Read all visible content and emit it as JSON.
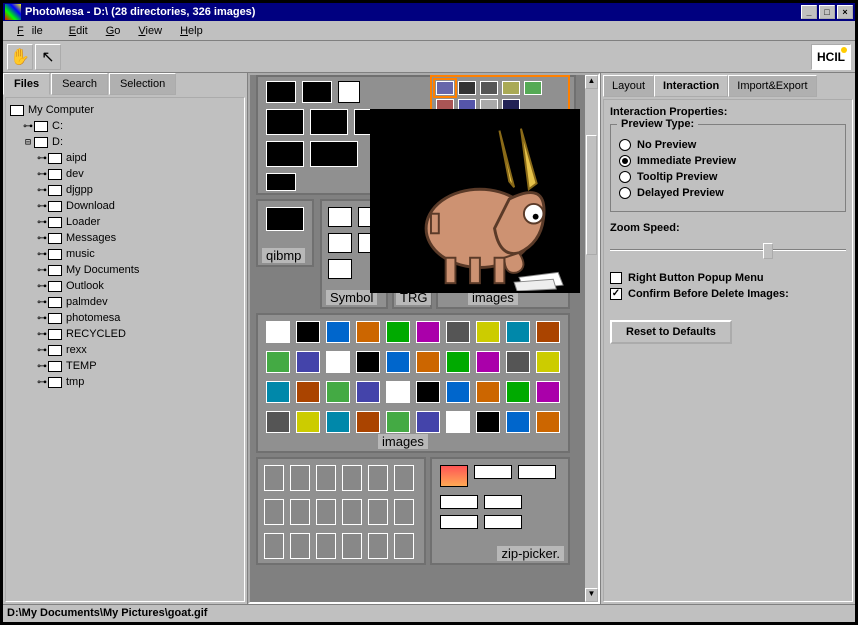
{
  "window": {
    "title": "PhotoMesa - D:\\   (28 directories, 326 images)",
    "buttons": {
      "min": "_",
      "max": "□",
      "close": "×"
    }
  },
  "menu": [
    "File",
    "Edit",
    "Go",
    "View",
    "Help"
  ],
  "toolbar_icons": {
    "hand": "✋",
    "pointer": "↖"
  },
  "logo_text": "HCIL",
  "left_tabs": {
    "files": "Files",
    "search": "Search",
    "selection": "Selection"
  },
  "tree": {
    "root": "My Computer",
    "c_drive": "C:",
    "d_drive": "D:",
    "d_children": [
      "aipd",
      "dev",
      "djgpp",
      "Download",
      "Loader",
      "Messages",
      "music",
      "My Documents",
      "Outlook",
      "palmdev",
      "photomesa",
      "RECYCLED",
      "rexx",
      "TEMP",
      "tmp"
    ]
  },
  "center_labels": {
    "qibmp": "qibmp",
    "symbol": "Symbol",
    "trg": "TRG",
    "images1": "images",
    "images2": "images",
    "zip": "zip-picker."
  },
  "right_tabs": {
    "layout": "Layout",
    "interaction": "Interaction",
    "importexport": "Import&Export"
  },
  "right": {
    "heading": "Interaction Properties:",
    "preview_title": "Preview Type:",
    "radios": {
      "no": "No Preview",
      "immediate": "Immediate Preview",
      "tooltip": "Tooltip Preview",
      "delayed": "Delayed Preview",
      "selected": "immediate"
    },
    "zoom_label": "Zoom Speed:",
    "checkboxes": {
      "rightbutton": "Right Button Popup Menu",
      "rightbutton_checked": false,
      "confirm": "Confirm Before Delete Images:",
      "confirm_checked": true
    },
    "reset_button": "Reset to Defaults"
  },
  "statusbar": "D:\\My Documents\\My Pictures\\goat.gif"
}
